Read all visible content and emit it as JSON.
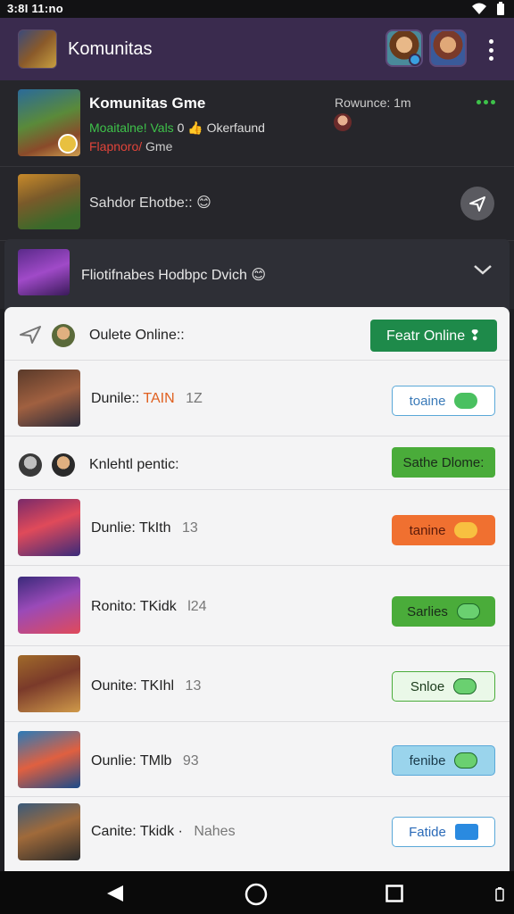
{
  "status_bar": {
    "time": "3:8I 11:no"
  },
  "app_bar": {
    "title": "Komunitas"
  },
  "posts": [
    {
      "title": "Komunitas Gme",
      "line2_green": "Moaitalne! Vals",
      "line2_rest": "0 👍 Okerfaund",
      "line3_red": "Flapnoro/",
      "line3_rest": "Gme",
      "meta": "Rowunce: 1m"
    },
    {
      "title": "Sahdor Ehotbe::",
      "emoji": "😊"
    }
  ],
  "expander": {
    "title": "Fliotifnabes Hodbpc Dvich",
    "emoji": "😊"
  },
  "panel": {
    "header1": {
      "label": "Oulete Online::",
      "button": "Featr Online ❢"
    },
    "header2": {
      "label": "Knlehtl pentic:",
      "button": "Sathe Dlome:"
    },
    "games": [
      {
        "name": "Dunile::",
        "tag": "TAIN",
        "num": "1Z",
        "button": "toaine"
      },
      {
        "name": "Dunlie: TkIth",
        "num": "13",
        "button": "tanine"
      },
      {
        "name": "Ronito: TKidk",
        "num": "Ɩ24",
        "button": "Sarlies"
      },
      {
        "name": "Ounite: TKIhl",
        "num": "13",
        "button": "Snloe"
      },
      {
        "name": "Ounlie: TMlb",
        "num": "93",
        "button": "fenibe"
      },
      {
        "name": "Canite: Tkidk ·",
        "num": "Nahes",
        "button": "Fatide"
      }
    ]
  },
  "colors": {
    "app_bar": "#3a2b4e",
    "green_dark": "#1e8a4a",
    "green": "#4aac3a",
    "orange": "#f07030",
    "blue_outline": "#5aa8d8"
  }
}
